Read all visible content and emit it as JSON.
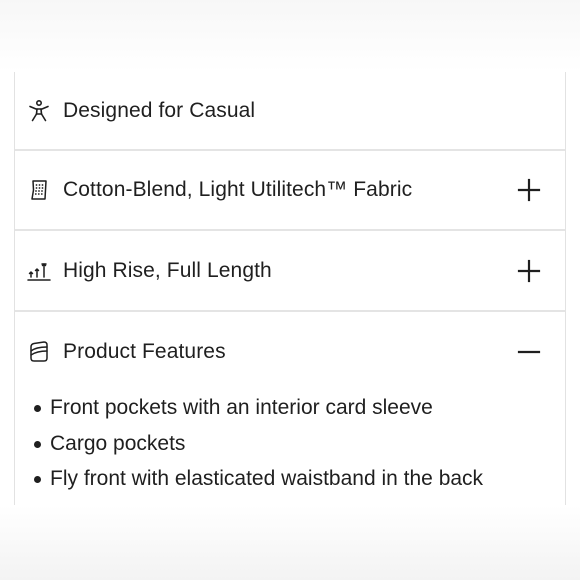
{
  "accordion": {
    "items": [
      {
        "label": "Designed for Casual",
        "icon": "person-icon",
        "expandable": false
      },
      {
        "label": "Cotton-Blend, Light Utilitech™ Fabric",
        "icon": "fabric-swatch-icon",
        "toggle_icon": "plus-icon",
        "expanded": false
      },
      {
        "label": "High Rise, Full Length",
        "icon": "rise-arrows-icon",
        "toggle_icon": "plus-icon",
        "expanded": false
      },
      {
        "label": "Product Features",
        "icon": "tag-icon",
        "toggle_icon": "minus-icon",
        "expanded": true,
        "details": [
          "Front pockets with an interior card sleeve",
          "Cargo pockets",
          "Fly front with elasticated waistband in the back"
        ]
      }
    ]
  },
  "colors": {
    "text": "#1f1f1f",
    "divider": "#e4e4e4",
    "background": "#ffffff"
  }
}
